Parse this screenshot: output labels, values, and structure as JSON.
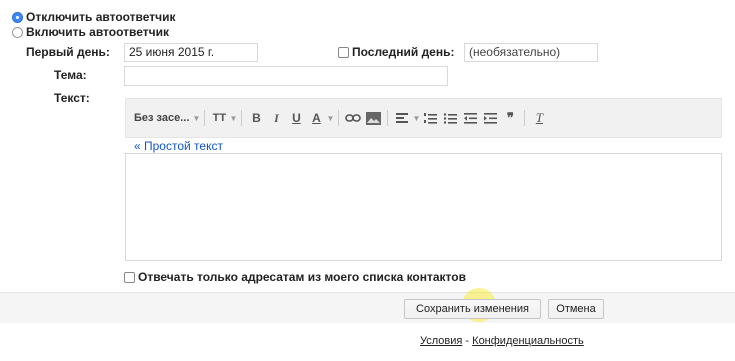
{
  "autoresponder": {
    "off_label": "Отключить автоответчик",
    "on_label": "Включить автоответчик",
    "selected": "off"
  },
  "first_day": {
    "label": "Первый день:",
    "value": "25 июня 2015 г."
  },
  "last_day": {
    "label": "Последний день:",
    "placeholder": "(необязательно)",
    "checked": false
  },
  "subject": {
    "label": "Тема:",
    "value": ""
  },
  "text": {
    "label": "Текст:"
  },
  "toolbar": {
    "font_label": "Без засе...",
    "font_size_icon": "TT",
    "bold": "B",
    "italic": "I",
    "underline": "U",
    "text_color": "A",
    "quote": "❞",
    "clear_format": "T"
  },
  "plain_text_link": "« Простой текст",
  "body_value": "",
  "contacts_only": {
    "label": "Отвечать только адресатам из моего списка контактов",
    "checked": false
  },
  "buttons": {
    "save": "Сохранить изменения",
    "cancel": "Отмена"
  },
  "footer": {
    "terms": "Условия",
    "separator": "-",
    "privacy": "Конфиденциальность"
  }
}
